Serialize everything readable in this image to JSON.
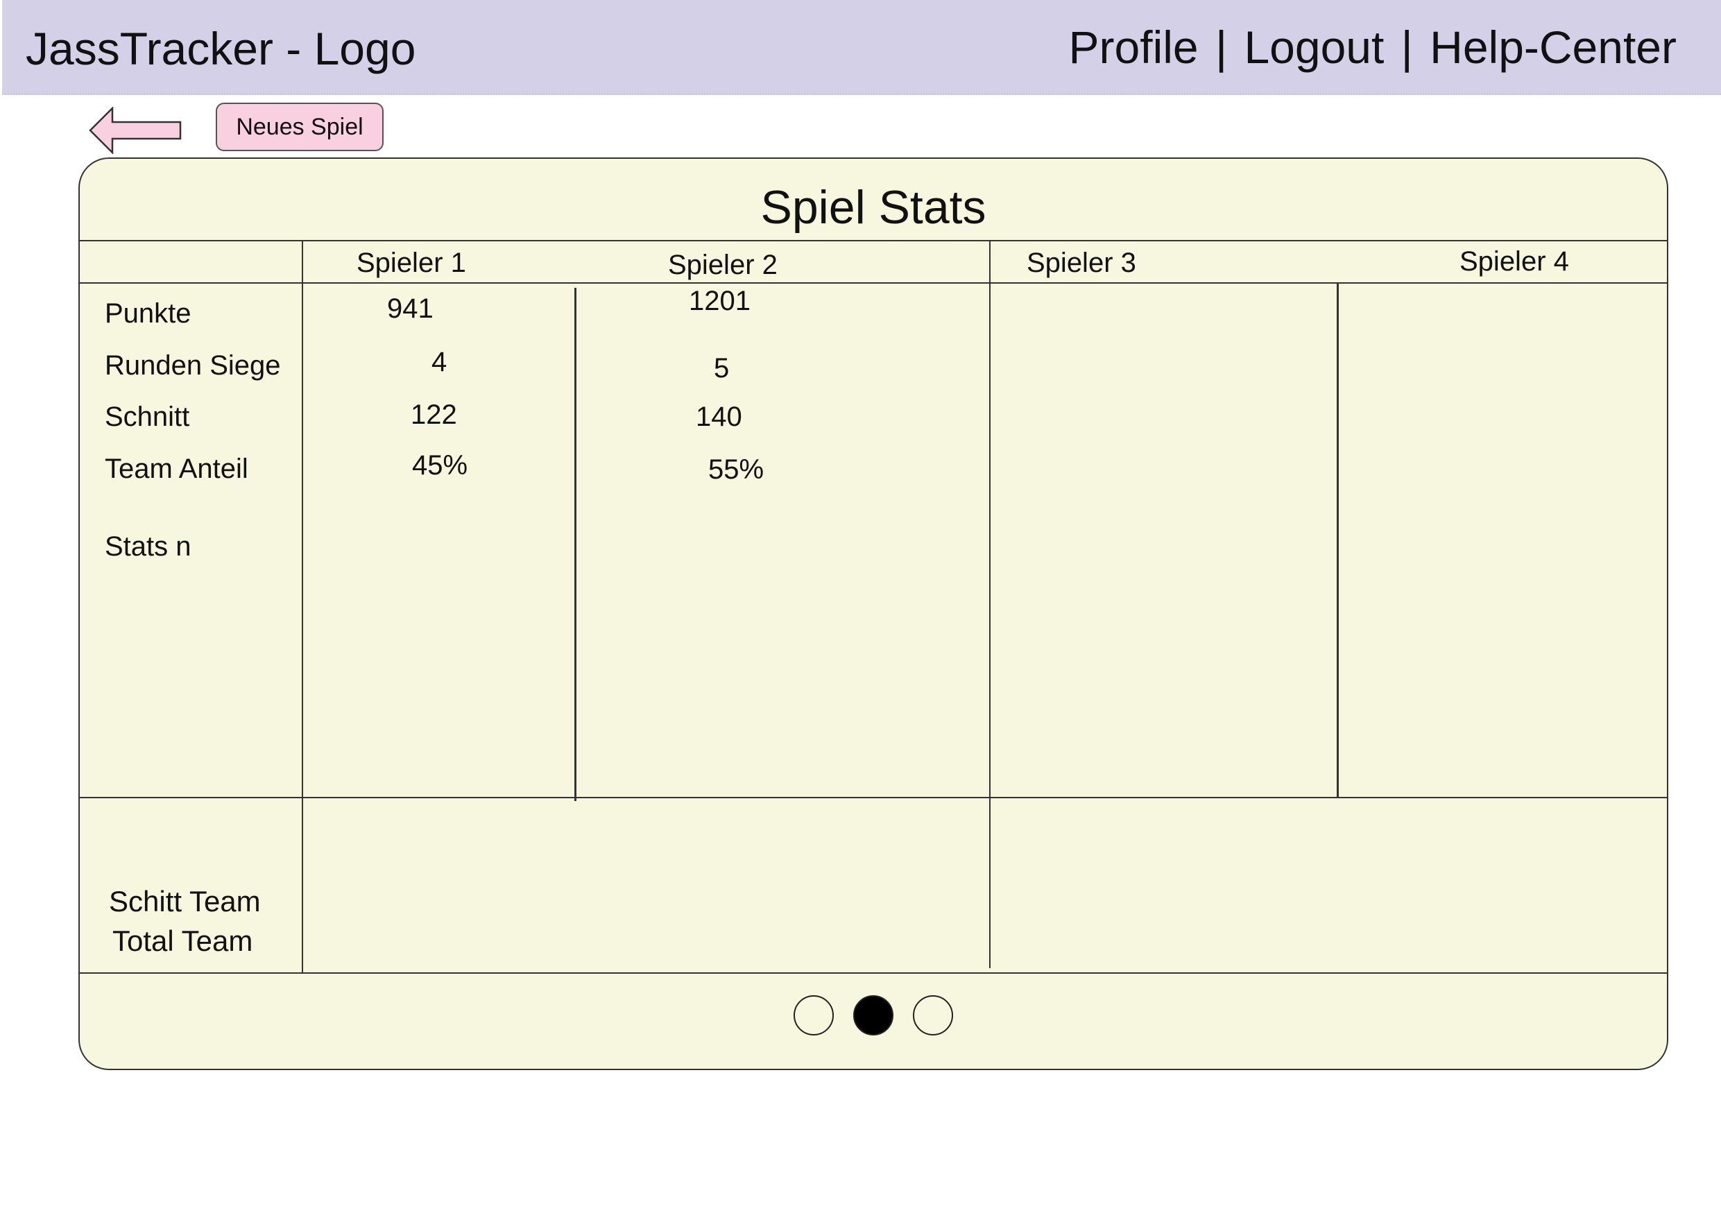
{
  "header": {
    "logo_text": "JassTracker - Logo",
    "nav": {
      "profile": "Profile",
      "logout": "Logout",
      "help": "Help-Center",
      "separator": "|"
    },
    "background_color": "#d4d0e8"
  },
  "toolbar": {
    "back_icon": "left-arrow-icon",
    "new_game_label": "Neues Spiel",
    "new_game_color": "#f8d0e0"
  },
  "stats": {
    "title": "Spiel Stats",
    "background_color": "#f7f7df",
    "players": [
      "Spieler 1",
      "Spieler 2",
      "Spieler 3",
      "Spieler 4"
    ],
    "rows": [
      {
        "label": "Punkte",
        "values": [
          "941",
          "1201",
          "",
          ""
        ]
      },
      {
        "label": "Runden Siege",
        "values": [
          "4",
          "5",
          "",
          ""
        ]
      },
      {
        "label": "Schnitt",
        "values": [
          "122",
          "140",
          "",
          ""
        ]
      },
      {
        "label": "Team Anteil",
        "values": [
          "45%",
          "55%",
          "",
          ""
        ]
      },
      {
        "label": "Stats n",
        "values": [
          "",
          "",
          "",
          ""
        ]
      }
    ],
    "team": {
      "average_label": "Schitt Team",
      "total_label": "Total Team"
    }
  },
  "pagination": {
    "pages": 3,
    "active_index": 1
  }
}
